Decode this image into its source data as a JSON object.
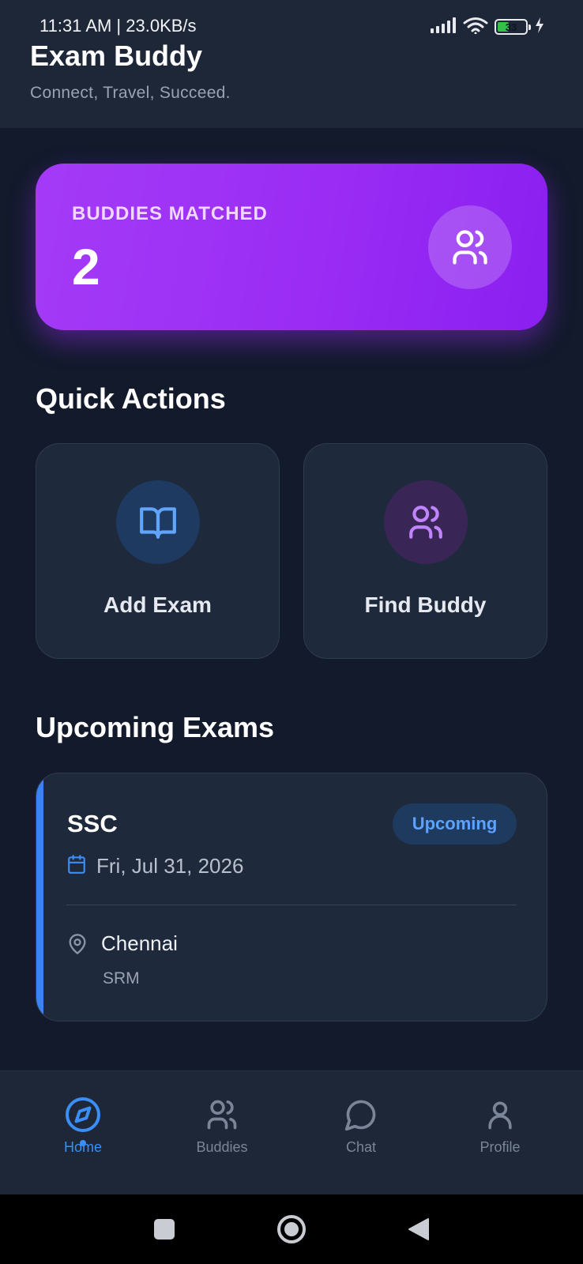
{
  "status_bar": {
    "time_speed": "11:31 AM | 23.0KB/s",
    "battery": "33",
    "icons": [
      "signal-icon",
      "wifi-icon",
      "battery-icon",
      "charging-icon"
    ]
  },
  "header": {
    "title": "Exam Buddy",
    "tagline": "Connect, Travel, Succeed."
  },
  "matched_card": {
    "label": "BUDDIES MATCHED",
    "count": "2",
    "icon": "users-icon"
  },
  "quick_actions": {
    "title": "Quick Actions",
    "items": [
      {
        "label": "Add Exam",
        "icon": "book-open-icon",
        "icon_color": "#60a5fa",
        "icon_bg": "#1f3a60"
      },
      {
        "label": "Find Buddy",
        "icon": "users-icon",
        "icon_color": "#c084fc",
        "icon_bg": "#3a2656"
      }
    ]
  },
  "upcoming_exams": {
    "title": "Upcoming Exams",
    "items": [
      {
        "name": "SSC",
        "status": "Upcoming",
        "date": "Fri, Jul 31, 2026",
        "city": "Chennai",
        "venue": "SRM"
      }
    ]
  },
  "bottom_nav": {
    "items": [
      {
        "label": "Home",
        "icon": "compass-icon",
        "active": true
      },
      {
        "label": "Buddies",
        "icon": "users-icon",
        "active": false
      },
      {
        "label": "Chat",
        "icon": "chat-bubble-icon",
        "active": false
      },
      {
        "label": "Profile",
        "icon": "user-icon",
        "active": false
      }
    ]
  },
  "colors": {
    "background": "#121a2b",
    "card": "#1e293b",
    "accent_blue": "#3b82f6",
    "accent_purple": "#9a2cf4"
  }
}
